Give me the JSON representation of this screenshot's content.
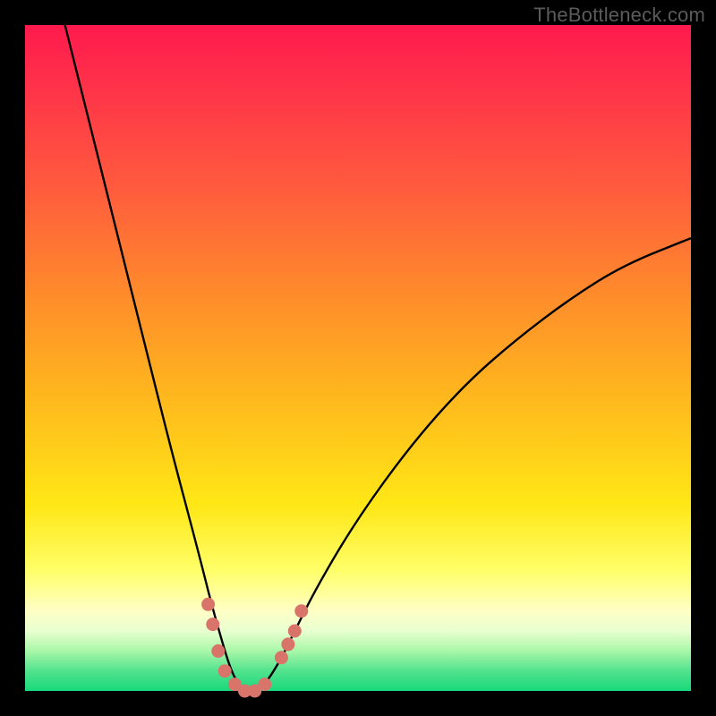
{
  "watermark": "TheBottleneck.com",
  "colors": {
    "page_bg": "#000000",
    "gradient_top": "#ff1a4d",
    "gradient_bottom": "#18d97a",
    "curve": "#000000",
    "marker": "#d9746b"
  },
  "chart_data": {
    "type": "line",
    "title": "",
    "xlabel": "",
    "ylabel": "",
    "xlim": [
      0,
      100
    ],
    "ylim": [
      0,
      100
    ],
    "notes": "V-shaped bottleneck curve. y=100 at top (worst), y=0 at bottom (best/green). Minimum near x≈33. Left branch steep, right branch shallower approaching ~68 at x=100.",
    "curve": [
      {
        "x": 6,
        "y": 100
      },
      {
        "x": 10,
        "y": 84
      },
      {
        "x": 14,
        "y": 68
      },
      {
        "x": 18,
        "y": 52
      },
      {
        "x": 22,
        "y": 36
      },
      {
        "x": 26,
        "y": 21
      },
      {
        "x": 28,
        "y": 13
      },
      {
        "x": 30,
        "y": 6
      },
      {
        "x": 31,
        "y": 3
      },
      {
        "x": 32,
        "y": 1
      },
      {
        "x": 33,
        "y": 0
      },
      {
        "x": 34,
        "y": 0
      },
      {
        "x": 35,
        "y": 0
      },
      {
        "x": 36,
        "y": 1
      },
      {
        "x": 38,
        "y": 4
      },
      {
        "x": 40,
        "y": 8
      },
      {
        "x": 44,
        "y": 16
      },
      {
        "x": 50,
        "y": 26
      },
      {
        "x": 58,
        "y": 37
      },
      {
        "x": 66,
        "y": 46
      },
      {
        "x": 74,
        "y": 53
      },
      {
        "x": 82,
        "y": 59
      },
      {
        "x": 90,
        "y": 64
      },
      {
        "x": 100,
        "y": 68
      }
    ],
    "markers": [
      {
        "x": 27.5,
        "y": 13
      },
      {
        "x": 28.2,
        "y": 10
      },
      {
        "x": 29.0,
        "y": 6
      },
      {
        "x": 30.0,
        "y": 3
      },
      {
        "x": 31.5,
        "y": 1
      },
      {
        "x": 33.0,
        "y": 0
      },
      {
        "x": 34.5,
        "y": 0
      },
      {
        "x": 36.0,
        "y": 1
      },
      {
        "x": 38.5,
        "y": 5
      },
      {
        "x": 39.5,
        "y": 7
      },
      {
        "x": 40.5,
        "y": 9
      },
      {
        "x": 41.5,
        "y": 12
      }
    ]
  }
}
